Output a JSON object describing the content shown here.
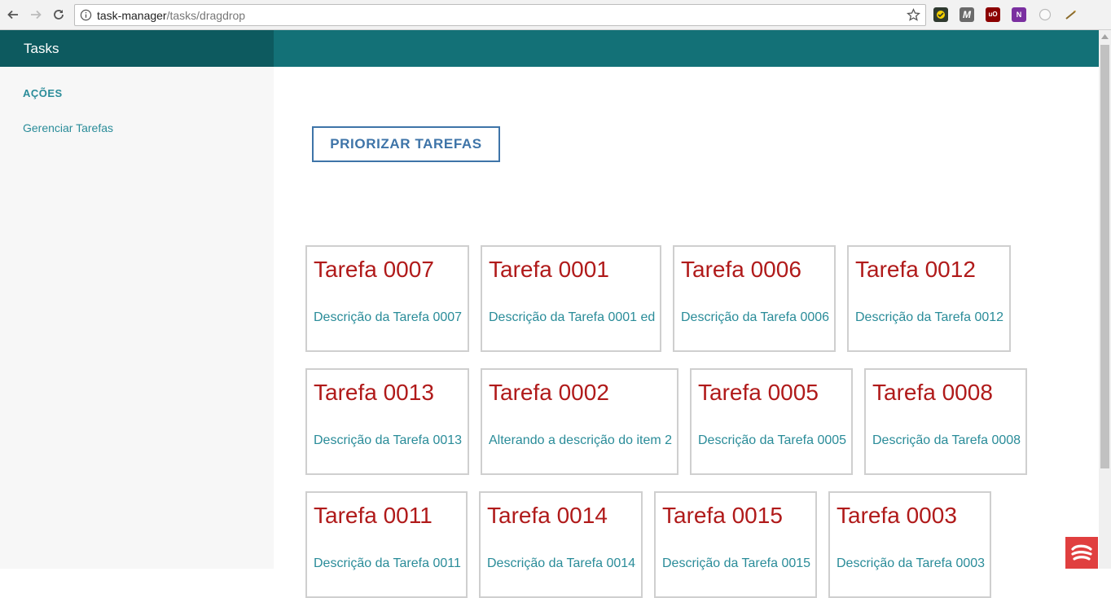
{
  "browser": {
    "url_host": "task-manager",
    "url_path": "/tasks/dragdrop"
  },
  "header": {
    "brand": "Tasks"
  },
  "sidebar": {
    "heading": "AÇÕES",
    "links": [
      {
        "label": "Gerenciar Tarefas"
      }
    ]
  },
  "main": {
    "prioritize_label": "PRIORIZAR TAREFAS",
    "cards": [
      {
        "title": "Tarefa 0007",
        "desc": "Descrição da Tarefa 0007"
      },
      {
        "title": "Tarefa 0001",
        "desc": "Descrição da Tarefa 0001 ed"
      },
      {
        "title": "Tarefa 0006",
        "desc": "Descrição da Tarefa 0006"
      },
      {
        "title": "Tarefa 0012",
        "desc": "Descrição da Tarefa 0012"
      },
      {
        "title": "Tarefa 0013",
        "desc": "Descrição da Tarefa 0013"
      },
      {
        "title": "Tarefa 0002",
        "desc": "Alterando a descrição do item 2"
      },
      {
        "title": "Tarefa 0005",
        "desc": "Descrição da Tarefa 0005"
      },
      {
        "title": "Tarefa 0008",
        "desc": "Descrição da Tarefa 0008"
      },
      {
        "title": "Tarefa 0011",
        "desc": "Descrição da Tarefa 0011"
      },
      {
        "title": "Tarefa 0014",
        "desc": "Descrição da Tarefa 0014"
      },
      {
        "title": "Tarefa 0015",
        "desc": "Descrição da Tarefa 0015"
      },
      {
        "title": "Tarefa 0003",
        "desc": "Descrição da Tarefa 0003"
      }
    ]
  },
  "colors": {
    "header": "#137177",
    "brand_bg": "#0d5a5f",
    "link": "#2a8c99",
    "card_title": "#b01a1a",
    "button": "#3e74a8"
  },
  "extensions": [
    "check-extension-icon",
    "m-extension-icon",
    "ublock-extension-icon",
    "onenote-extension-icon",
    "circle-extension-icon",
    "pen-extension-icon"
  ]
}
